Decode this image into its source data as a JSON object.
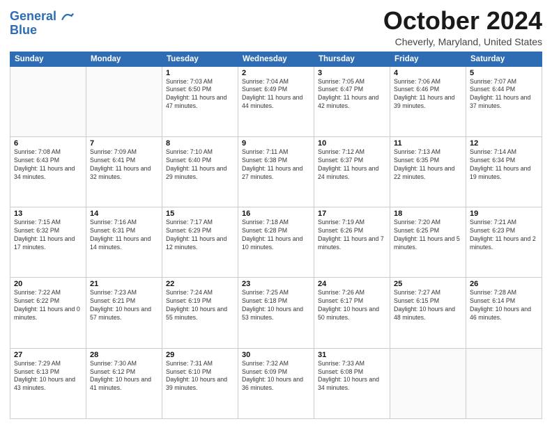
{
  "header": {
    "logo_line1": "General",
    "logo_line2": "Blue",
    "month_title": "October 2024",
    "location": "Cheverly, Maryland, United States"
  },
  "weekdays": [
    "Sunday",
    "Monday",
    "Tuesday",
    "Wednesday",
    "Thursday",
    "Friday",
    "Saturday"
  ],
  "weeks": [
    [
      {
        "day": "",
        "sunrise": "",
        "sunset": "",
        "daylight": ""
      },
      {
        "day": "",
        "sunrise": "",
        "sunset": "",
        "daylight": ""
      },
      {
        "day": "1",
        "sunrise": "Sunrise: 7:03 AM",
        "sunset": "Sunset: 6:50 PM",
        "daylight": "Daylight: 11 hours and 47 minutes."
      },
      {
        "day": "2",
        "sunrise": "Sunrise: 7:04 AM",
        "sunset": "Sunset: 6:49 PM",
        "daylight": "Daylight: 11 hours and 44 minutes."
      },
      {
        "day": "3",
        "sunrise": "Sunrise: 7:05 AM",
        "sunset": "Sunset: 6:47 PM",
        "daylight": "Daylight: 11 hours and 42 minutes."
      },
      {
        "day": "4",
        "sunrise": "Sunrise: 7:06 AM",
        "sunset": "Sunset: 6:46 PM",
        "daylight": "Daylight: 11 hours and 39 minutes."
      },
      {
        "day": "5",
        "sunrise": "Sunrise: 7:07 AM",
        "sunset": "Sunset: 6:44 PM",
        "daylight": "Daylight: 11 hours and 37 minutes."
      }
    ],
    [
      {
        "day": "6",
        "sunrise": "Sunrise: 7:08 AM",
        "sunset": "Sunset: 6:43 PM",
        "daylight": "Daylight: 11 hours and 34 minutes."
      },
      {
        "day": "7",
        "sunrise": "Sunrise: 7:09 AM",
        "sunset": "Sunset: 6:41 PM",
        "daylight": "Daylight: 11 hours and 32 minutes."
      },
      {
        "day": "8",
        "sunrise": "Sunrise: 7:10 AM",
        "sunset": "Sunset: 6:40 PM",
        "daylight": "Daylight: 11 hours and 29 minutes."
      },
      {
        "day": "9",
        "sunrise": "Sunrise: 7:11 AM",
        "sunset": "Sunset: 6:38 PM",
        "daylight": "Daylight: 11 hours and 27 minutes."
      },
      {
        "day": "10",
        "sunrise": "Sunrise: 7:12 AM",
        "sunset": "Sunset: 6:37 PM",
        "daylight": "Daylight: 11 hours and 24 minutes."
      },
      {
        "day": "11",
        "sunrise": "Sunrise: 7:13 AM",
        "sunset": "Sunset: 6:35 PM",
        "daylight": "Daylight: 11 hours and 22 minutes."
      },
      {
        "day": "12",
        "sunrise": "Sunrise: 7:14 AM",
        "sunset": "Sunset: 6:34 PM",
        "daylight": "Daylight: 11 hours and 19 minutes."
      }
    ],
    [
      {
        "day": "13",
        "sunrise": "Sunrise: 7:15 AM",
        "sunset": "Sunset: 6:32 PM",
        "daylight": "Daylight: 11 hours and 17 minutes."
      },
      {
        "day": "14",
        "sunrise": "Sunrise: 7:16 AM",
        "sunset": "Sunset: 6:31 PM",
        "daylight": "Daylight: 11 hours and 14 minutes."
      },
      {
        "day": "15",
        "sunrise": "Sunrise: 7:17 AM",
        "sunset": "Sunset: 6:29 PM",
        "daylight": "Daylight: 11 hours and 12 minutes."
      },
      {
        "day": "16",
        "sunrise": "Sunrise: 7:18 AM",
        "sunset": "Sunset: 6:28 PM",
        "daylight": "Daylight: 11 hours and 10 minutes."
      },
      {
        "day": "17",
        "sunrise": "Sunrise: 7:19 AM",
        "sunset": "Sunset: 6:26 PM",
        "daylight": "Daylight: 11 hours and 7 minutes."
      },
      {
        "day": "18",
        "sunrise": "Sunrise: 7:20 AM",
        "sunset": "Sunset: 6:25 PM",
        "daylight": "Daylight: 11 hours and 5 minutes."
      },
      {
        "day": "19",
        "sunrise": "Sunrise: 7:21 AM",
        "sunset": "Sunset: 6:23 PM",
        "daylight": "Daylight: 11 hours and 2 minutes."
      }
    ],
    [
      {
        "day": "20",
        "sunrise": "Sunrise: 7:22 AM",
        "sunset": "Sunset: 6:22 PM",
        "daylight": "Daylight: 11 hours and 0 minutes."
      },
      {
        "day": "21",
        "sunrise": "Sunrise: 7:23 AM",
        "sunset": "Sunset: 6:21 PM",
        "daylight": "Daylight: 10 hours and 57 minutes."
      },
      {
        "day": "22",
        "sunrise": "Sunrise: 7:24 AM",
        "sunset": "Sunset: 6:19 PM",
        "daylight": "Daylight: 10 hours and 55 minutes."
      },
      {
        "day": "23",
        "sunrise": "Sunrise: 7:25 AM",
        "sunset": "Sunset: 6:18 PM",
        "daylight": "Daylight: 10 hours and 53 minutes."
      },
      {
        "day": "24",
        "sunrise": "Sunrise: 7:26 AM",
        "sunset": "Sunset: 6:17 PM",
        "daylight": "Daylight: 10 hours and 50 minutes."
      },
      {
        "day": "25",
        "sunrise": "Sunrise: 7:27 AM",
        "sunset": "Sunset: 6:15 PM",
        "daylight": "Daylight: 10 hours and 48 minutes."
      },
      {
        "day": "26",
        "sunrise": "Sunrise: 7:28 AM",
        "sunset": "Sunset: 6:14 PM",
        "daylight": "Daylight: 10 hours and 46 minutes."
      }
    ],
    [
      {
        "day": "27",
        "sunrise": "Sunrise: 7:29 AM",
        "sunset": "Sunset: 6:13 PM",
        "daylight": "Daylight: 10 hours and 43 minutes."
      },
      {
        "day": "28",
        "sunrise": "Sunrise: 7:30 AM",
        "sunset": "Sunset: 6:12 PM",
        "daylight": "Daylight: 10 hours and 41 minutes."
      },
      {
        "day": "29",
        "sunrise": "Sunrise: 7:31 AM",
        "sunset": "Sunset: 6:10 PM",
        "daylight": "Daylight: 10 hours and 39 minutes."
      },
      {
        "day": "30",
        "sunrise": "Sunrise: 7:32 AM",
        "sunset": "Sunset: 6:09 PM",
        "daylight": "Daylight: 10 hours and 36 minutes."
      },
      {
        "day": "31",
        "sunrise": "Sunrise: 7:33 AM",
        "sunset": "Sunset: 6:08 PM",
        "daylight": "Daylight: 10 hours and 34 minutes."
      },
      {
        "day": "",
        "sunrise": "",
        "sunset": "",
        "daylight": ""
      },
      {
        "day": "",
        "sunrise": "",
        "sunset": "",
        "daylight": ""
      }
    ]
  ]
}
